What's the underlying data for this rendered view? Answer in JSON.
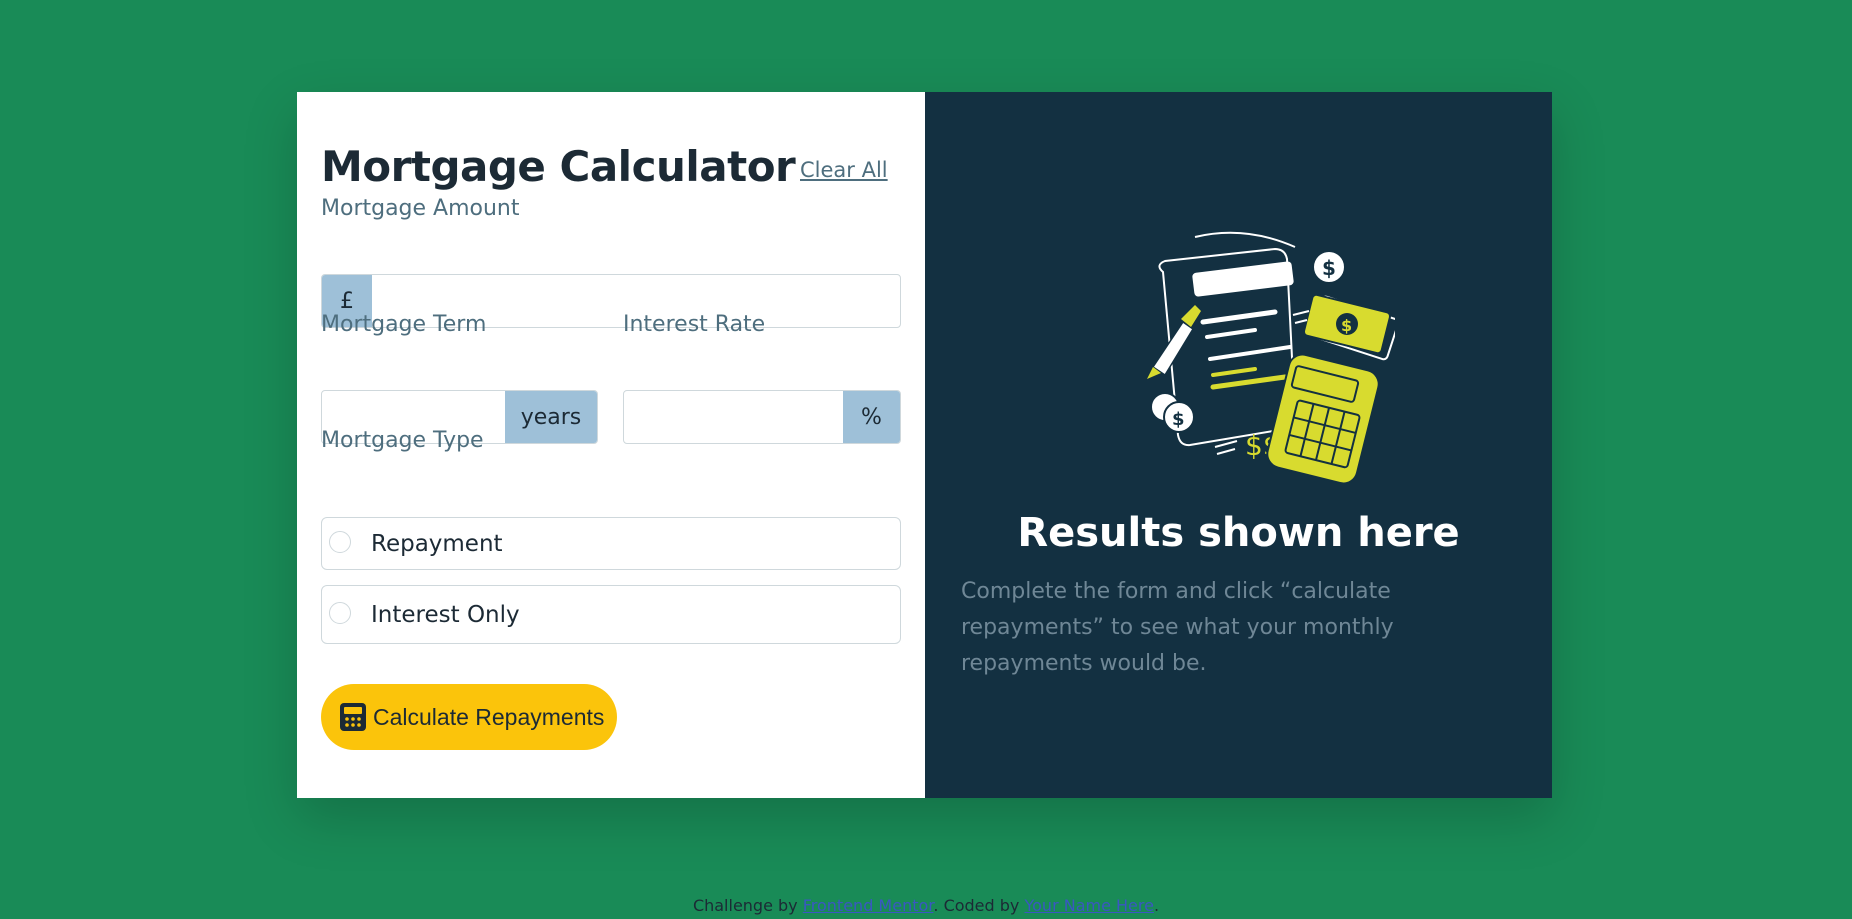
{
  "form": {
    "title": "Mortgage Calculator",
    "clear_label": "Clear All",
    "amount": {
      "label": "Mortgage Amount",
      "prefix": "£",
      "value": ""
    },
    "term": {
      "label": "Mortgage Term",
      "suffix": "years",
      "value": ""
    },
    "rate": {
      "label": "Interest Rate",
      "suffix": "%",
      "value": ""
    },
    "type": {
      "label": "Mortgage Type",
      "options": [
        "Repayment",
        "Interest Only"
      ]
    },
    "submit_label": "Calculate Repayments"
  },
  "results": {
    "title": "Results shown here",
    "description": "Complete the form and click “calculate repayments” to see what your monthly repayments would be.",
    "illustration_icon": "calculator-document-icon"
  },
  "footer": {
    "prefix": "Challenge by ",
    "link1": "Frontend Mentor",
    "middle": ". Coded by ",
    "link2": "Your Name Here",
    "suffix": "."
  },
  "colors": {
    "background": "#198b57",
    "panel_dark": "#133041",
    "accent_yellow": "#fbc40b",
    "addon_blue": "#9ec0d8",
    "lime": "#d8db2f"
  }
}
